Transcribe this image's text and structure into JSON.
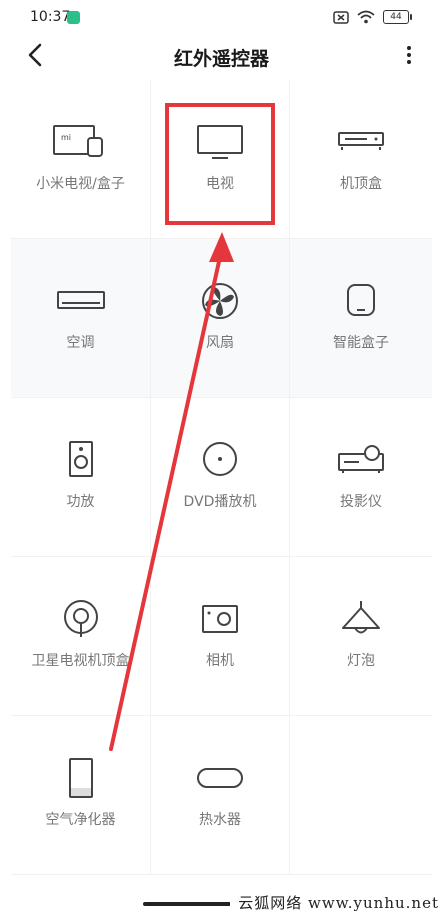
{
  "status_bar": {
    "time": "10:37",
    "battery": "44"
  },
  "header": {
    "title": "红外遥控器"
  },
  "devices": [
    {
      "label": "小米电视/盒子",
      "icon": "mi-tv-box-icon"
    },
    {
      "label": "电视",
      "icon": "tv-icon"
    },
    {
      "label": "机顶盒",
      "icon": "set-top-box-icon"
    },
    {
      "label": "空调",
      "icon": "air-conditioner-icon"
    },
    {
      "label": "风扇",
      "icon": "fan-icon"
    },
    {
      "label": "智能盒子",
      "icon": "smart-box-icon"
    },
    {
      "label": "功放",
      "icon": "amplifier-icon"
    },
    {
      "label": "DVD播放机",
      "icon": "dvd-player-icon"
    },
    {
      "label": "投影仪",
      "icon": "projector-icon"
    },
    {
      "label": "卫星电视机顶盒",
      "icon": "satellite-box-icon"
    },
    {
      "label": "相机",
      "icon": "camera-icon"
    },
    {
      "label": "灯泡",
      "icon": "lamp-icon"
    },
    {
      "label": "空气净化器",
      "icon": "air-purifier-icon"
    },
    {
      "label": "热水器",
      "icon": "water-heater-icon"
    }
  ],
  "annotation": {
    "color": "#e5363b"
  },
  "watermark": {
    "text": "云狐网络 www.yunhu.net"
  }
}
